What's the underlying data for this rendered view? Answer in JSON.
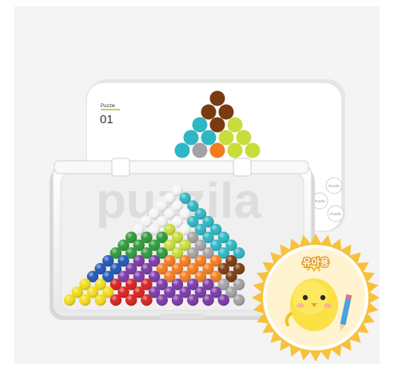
{
  "card": {
    "caption": "Puzzle",
    "number": "01",
    "side_buttons": [
      "Puzzle",
      "Puzzle",
      "Puzzle"
    ]
  },
  "watermark_text": "puzzila",
  "sticker": {
    "text": "유아용",
    "colors": {
      "burst": "#f7c23a",
      "face": "#fbe146",
      "pencil": "#4aa3df"
    }
  },
  "colors": {
    "background": "#f4f4f4",
    "brown": "#7a3b12",
    "teal": "#2fb6c4",
    "gray": "#a3a3a3",
    "orange": "#f47c20",
    "lime": "#c8dc3c",
    "purple": "#7c3aa8",
    "blue": "#2357b5",
    "green": "#2e9b3a",
    "yellow": "#f2dc1c",
    "red": "#d8221f",
    "navy": "#0e2f7a",
    "white": "#f5f5f5"
  }
}
